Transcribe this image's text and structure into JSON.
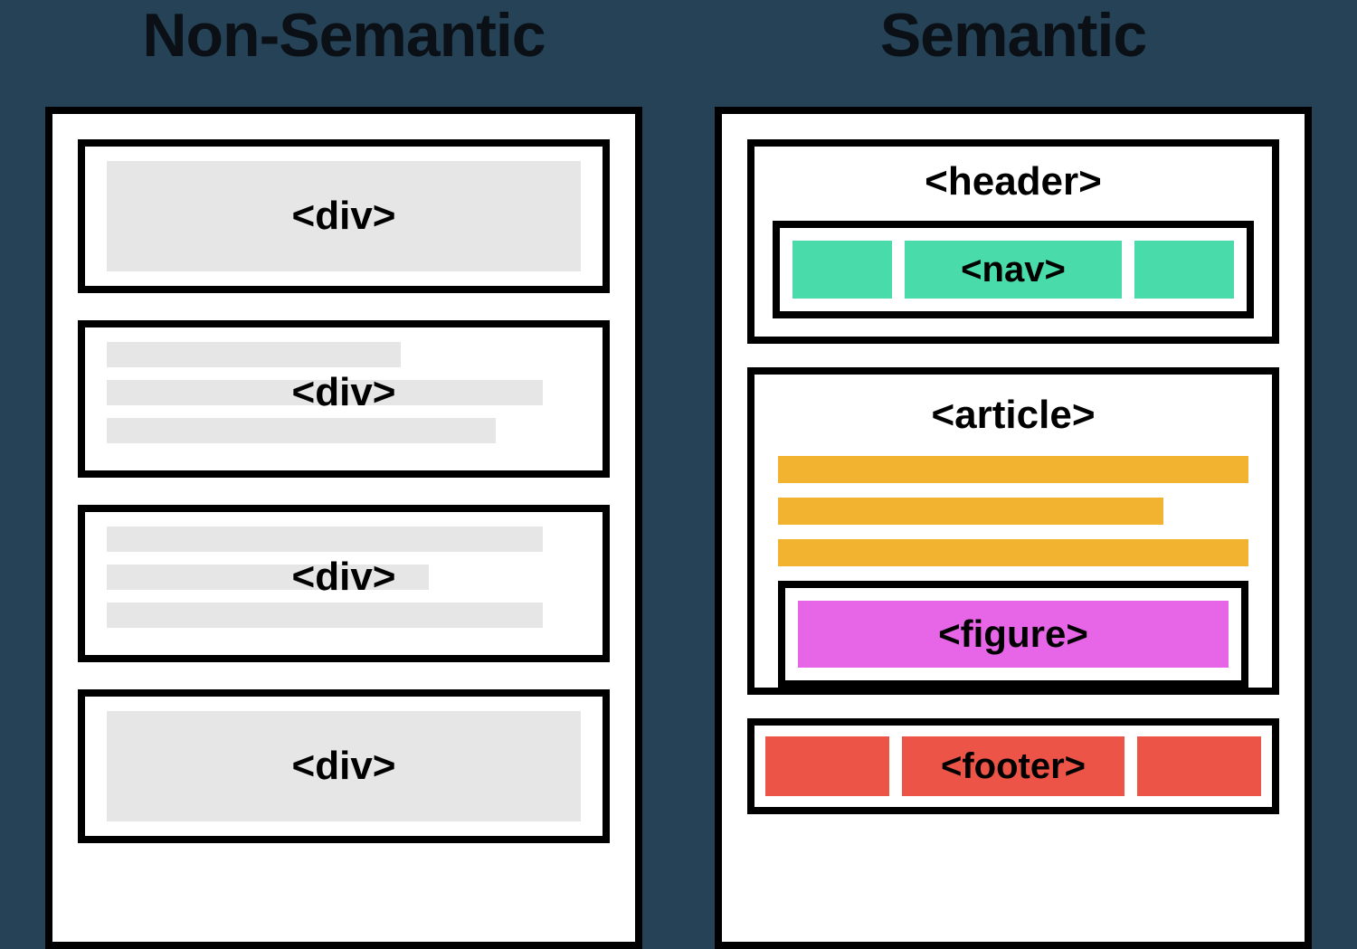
{
  "left": {
    "title": "Non-Semantic",
    "blocks": [
      {
        "label": "<div>"
      },
      {
        "label": "<div>"
      },
      {
        "label": "<div>"
      },
      {
        "label": "<div>"
      }
    ]
  },
  "right": {
    "title": "Semantic",
    "header_label": "<header>",
    "nav_label": "<nav>",
    "article_label": "<article>",
    "figure_label": "<figure>",
    "footer_label": "<footer>"
  },
  "colors": {
    "background": "#254257",
    "nav": "#49dbaa",
    "article_line": "#f2b430",
    "figure": "#e766e7",
    "footer": "#ec5448",
    "nonsemantic_fill": "#e6e6e6"
  }
}
